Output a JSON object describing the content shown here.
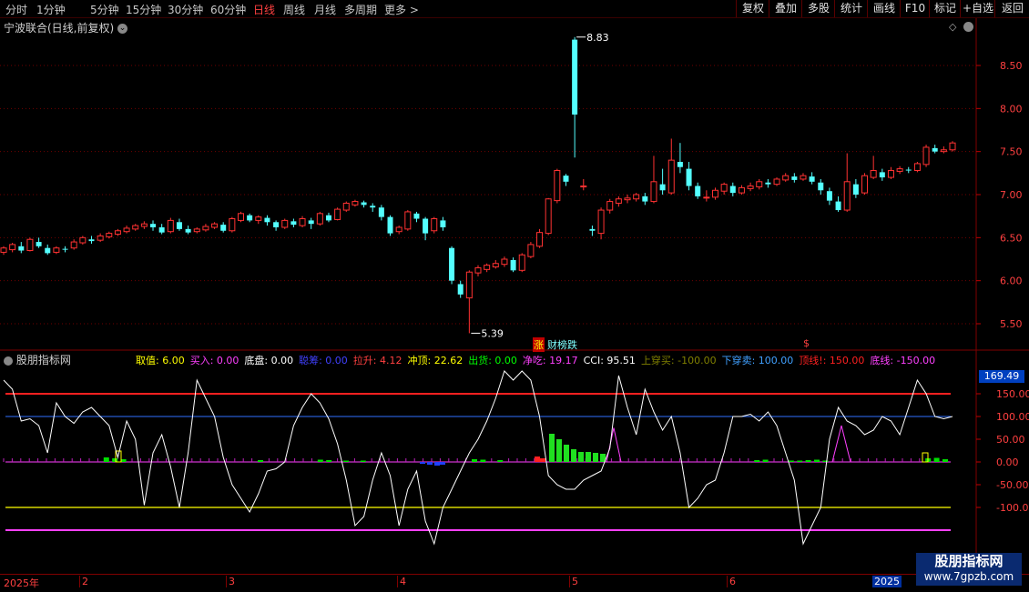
{
  "toolbar": {
    "periods": [
      "分时",
      "1分钟",
      "5分钟",
      "15分钟",
      "30分钟",
      "60分钟",
      "日线",
      "周线",
      "月线",
      "多周期",
      "更多 >"
    ],
    "active_period": "日线",
    "right_buttons": [
      "复权",
      "叠加",
      "多股",
      "统计",
      "画线",
      "F10",
      "标记",
      "+自选",
      "返回"
    ]
  },
  "main_panel": {
    "title": "宁波联合(日线,前复权)",
    "y_axis": [
      "8.50",
      "8.00",
      "7.50",
      "7.00",
      "6.50",
      "6.00",
      "5.50"
    ],
    "high_label": "8.83",
    "low_label": "5.39",
    "events": {
      "up": "涨",
      "board": "财榜跌",
      "s_mark": "$"
    }
  },
  "indicator_panel": {
    "title": "股朋指标网",
    "readouts": [
      {
        "name": "取值",
        "value": "6.00",
        "color": "#ffff00"
      },
      {
        "name": "买入",
        "value": "0.00",
        "color": "#ff40ff"
      },
      {
        "name": "底盘",
        "value": "0.00",
        "color": "#ffffff"
      },
      {
        "name": "聪筹",
        "value": "0.00",
        "color": "#4040ff"
      },
      {
        "name": "拉升",
        "value": "4.12",
        "color": "#ff4040"
      },
      {
        "name": "冲顶",
        "value": "22.62",
        "color": "#ffff00"
      },
      {
        "name": "出货",
        "value": "0.00",
        "color": "#00ff00"
      },
      {
        "name": "净吃",
        "value": "19.17",
        "color": "#ff40ff"
      },
      {
        "name": "CCI",
        "value": "95.51",
        "color": "#ffffff"
      },
      {
        "name": "上穿买",
        "value": "-100.00",
        "color": "#808000"
      },
      {
        "name": "下穿卖",
        "value": "100.00",
        "color": "#40a0ff"
      },
      {
        "name": "顶线!",
        "value": "150.00",
        "color": "#ff2020"
      },
      {
        "name": "底线",
        "value": "-150.00",
        "color": "#ff40ff"
      }
    ],
    "y_axis": [
      "150.00",
      "100.00",
      "50.00",
      "0.00",
      "-50.00",
      "-100.00"
    ],
    "current_value": "169.49"
  },
  "date_axis": [
    "2025年",
    "2",
    "3",
    "4",
    "5",
    "6"
  ],
  "date_corner": "2025",
  "watermark": {
    "title": "股朋指标网",
    "url": "www.7gpzb.com"
  },
  "colors": {
    "up": "#ff3232",
    "down": "#54ffff",
    "grid": "#800000",
    "cci": "#ffffff"
  }
}
